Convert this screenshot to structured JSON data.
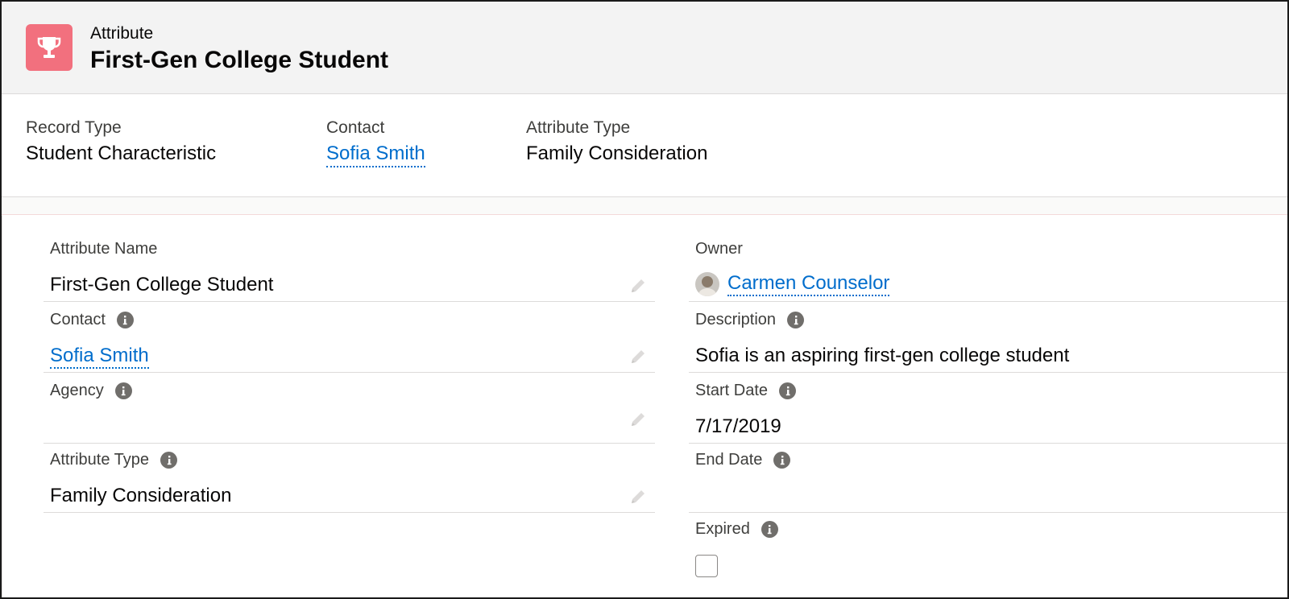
{
  "header": {
    "entity_label": "Attribute",
    "title": "First-Gen College Student",
    "icon": "trophy-icon",
    "icon_color": "#f2707e"
  },
  "highlights": [
    {
      "label": "Record Type",
      "value": "Student Characteristic"
    },
    {
      "label": "Contact",
      "value": "Sofia Smith"
    },
    {
      "label": "Attribute Type",
      "value": "Family Consideration"
    }
  ],
  "left_fields": [
    {
      "label": "Attribute Name",
      "value": "First-Gen College Student"
    },
    {
      "label": "Contact",
      "value": "Sofia Smith"
    },
    {
      "label": "Agency",
      "value": ""
    },
    {
      "label": "Attribute Type",
      "value": "Family Consideration"
    }
  ],
  "right_fields": [
    {
      "label": "Owner",
      "value": "Carmen Counselor"
    },
    {
      "label": "Description",
      "value": "Sofia is an aspiring first-gen college student"
    },
    {
      "label": "Start Date",
      "value": "7/17/2019"
    },
    {
      "label": "End Date",
      "value": ""
    },
    {
      "label": "Expired",
      "checked": false
    }
  ],
  "colors": {
    "link": "#006dcc",
    "label": "#3e3e3c",
    "info_icon": "#706e6b"
  }
}
